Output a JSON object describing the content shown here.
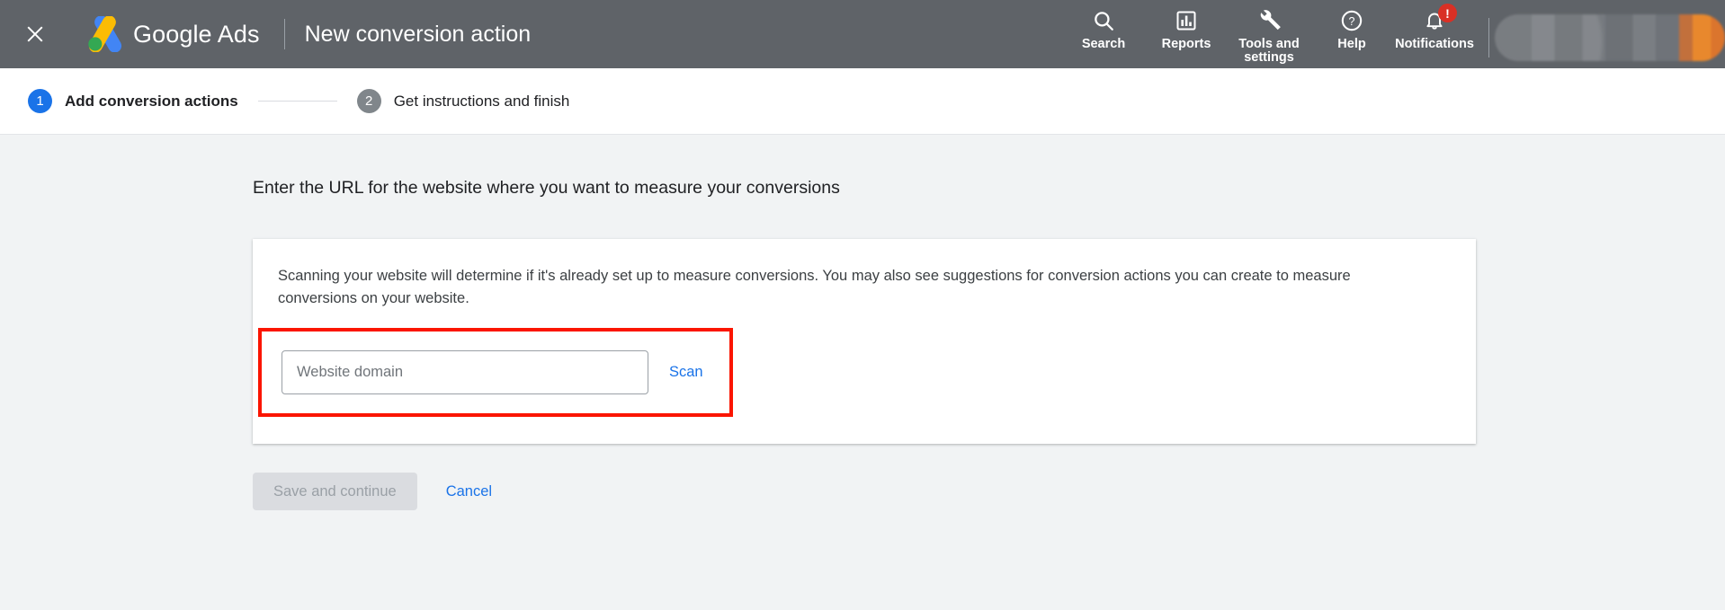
{
  "header": {
    "close_icon": "close-icon",
    "brand": "Google Ads",
    "page_title": "New conversion action",
    "actions": [
      {
        "label": "Search",
        "icon": "search-icon"
      },
      {
        "label": "Reports",
        "icon": "bar-chart-icon"
      },
      {
        "label": "Tools and\nsettings",
        "icon": "wrench-icon"
      },
      {
        "label": "Help",
        "icon": "help-circle-icon"
      },
      {
        "label": "Notifications",
        "icon": "bell-icon",
        "badge": "!"
      }
    ]
  },
  "stepper": {
    "steps": [
      {
        "number": "1",
        "label": "Add conversion actions",
        "state": "active"
      },
      {
        "number": "2",
        "label": "Get instructions and finish",
        "state": "inactive"
      }
    ]
  },
  "main": {
    "heading": "Enter the URL for the website where you want to measure your conversions",
    "card": {
      "description": "Scanning your website will determine if it's already set up to measure conversions. You may also see suggestions for conversion actions you can create to measure conversions on your website.",
      "domain_input": {
        "value": "",
        "placeholder": "Website domain"
      },
      "scan_label": "Scan"
    },
    "footer": {
      "save_label": "Save and continue",
      "cancel_label": "Cancel"
    }
  },
  "colors": {
    "header_bg": "#5f6368",
    "accent_blue": "#1a73e8",
    "page_bg": "#f1f3f4",
    "highlight_red": "#fb1500",
    "badge_red": "#d93025",
    "step_inactive": "#80868b"
  }
}
